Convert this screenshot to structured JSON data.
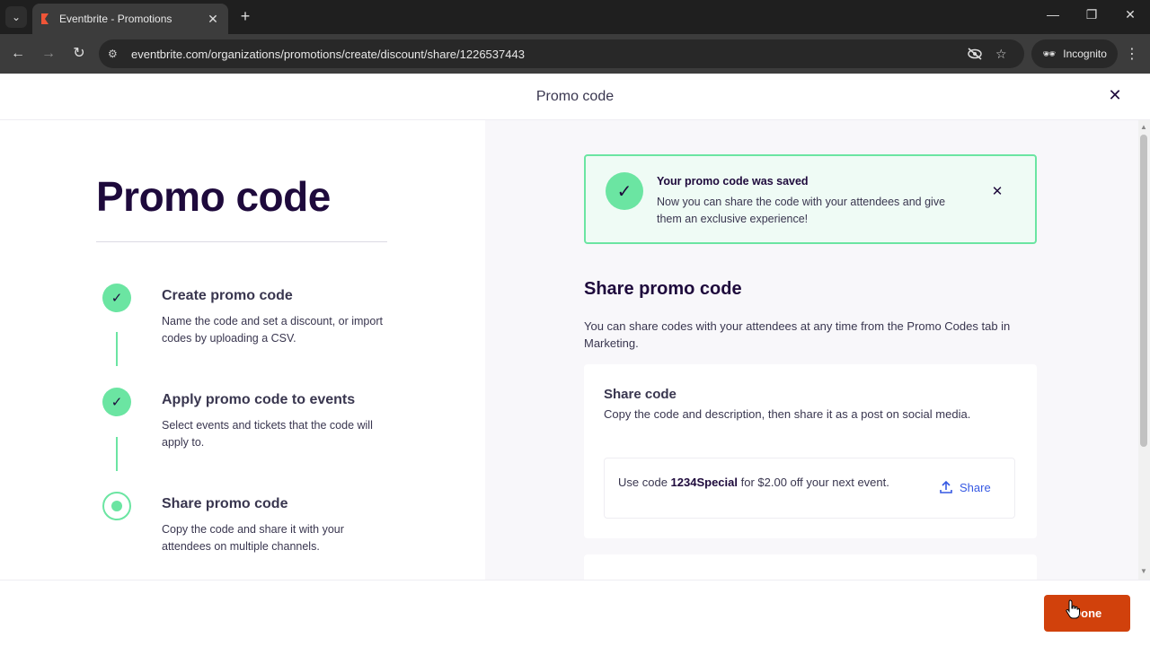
{
  "browser": {
    "tab_title": "Eventbrite - Promotions",
    "url": "eventbrite.com/organizations/promotions/create/discount/share/1226537443",
    "incognito_label": "Incognito"
  },
  "modal": {
    "header_title": "Promo code"
  },
  "left": {
    "title": "Promo code",
    "steps": [
      {
        "title": "Create promo code",
        "desc": "Name the code and set a discount, or import codes by uploading a CSV.",
        "state": "done"
      },
      {
        "title": "Apply promo code to events",
        "desc": "Select events and tickets that the code will apply to.",
        "state": "done"
      },
      {
        "title": "Share promo code",
        "desc": "Copy the code and share it with your attendees on multiple channels.",
        "state": "current"
      }
    ]
  },
  "alert": {
    "title": "Your promo code was saved",
    "text": "Now you can share the code with your attendees and give them an exclusive experience!"
  },
  "share": {
    "title": "Share promo code",
    "desc": "You can share codes with your attendees at any time from the Promo Codes tab in Marketing.",
    "card_title": "Share code",
    "card_desc": "Copy the code and description, then share it as a post on social media.",
    "code_prefix": "Use code ",
    "code": "1234Special",
    "code_suffix": " for $2.00 off your next event.",
    "share_label": "Share"
  },
  "footer": {
    "done_label": "Done"
  },
  "colors": {
    "accent_green": "#6be5a2",
    "brand_orange": "#d1410c",
    "link_blue": "#3659e3",
    "heading_purple": "#1e0a3c"
  }
}
